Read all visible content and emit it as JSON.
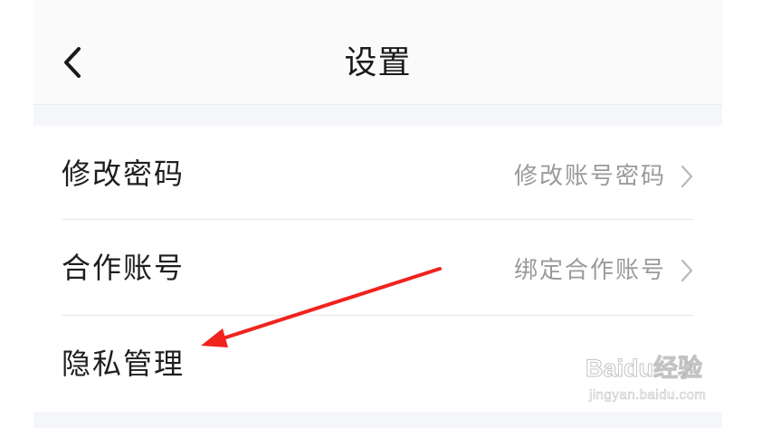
{
  "header": {
    "title": "设置",
    "back_icon": "chevron-left-icon"
  },
  "settings": [
    {
      "label": "修改密码",
      "value": "修改账号密码"
    },
    {
      "label": "合作账号",
      "value": "绑定合作账号"
    },
    {
      "label": "隐私管理",
      "value": ""
    }
  ],
  "annotation": {
    "arrow_color": "#f0231e"
  },
  "watermark": {
    "logo": "Baidu经验",
    "url": "jingyan.baidu.com"
  },
  "colors": {
    "background": "#f4f6f9",
    "header": "#fafafa",
    "label": "#1e1e1e",
    "value": "#9a9a9a"
  }
}
